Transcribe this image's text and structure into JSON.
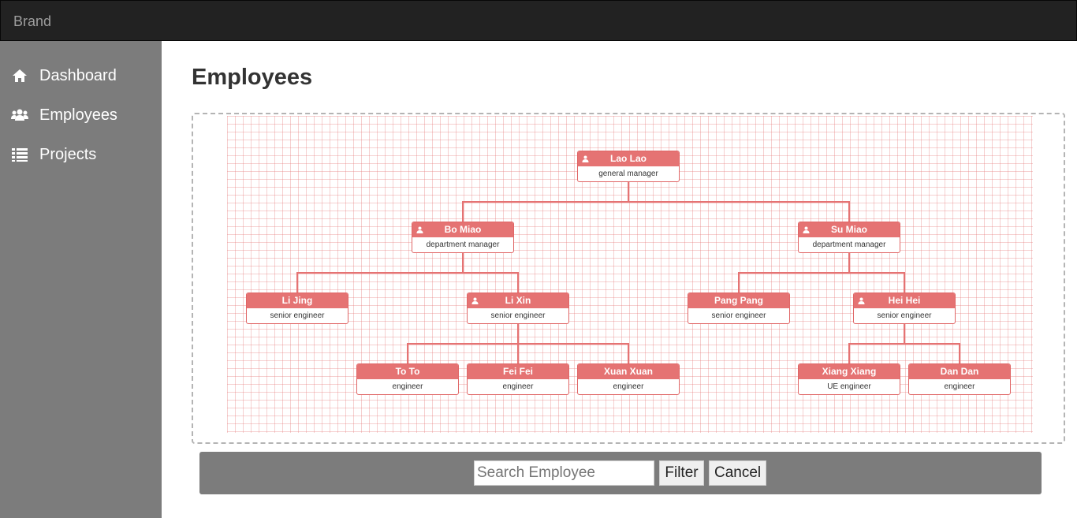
{
  "app": {
    "brand": "Brand"
  },
  "sidebar": {
    "items": [
      {
        "label": "Dashboard",
        "icon": "home-icon"
      },
      {
        "label": "Employees",
        "icon": "users-icon"
      },
      {
        "label": "Projects",
        "icon": "list-icon"
      }
    ]
  },
  "main": {
    "title": "Employees"
  },
  "org": {
    "accent": "#e57373",
    "nodes": [
      {
        "id": "lao",
        "name": "Lao Lao",
        "role": "general manager",
        "icon": "person-icon"
      },
      {
        "id": "bo",
        "name": "Bo Miao",
        "role": "department manager",
        "icon": "person-icon",
        "parent": "lao"
      },
      {
        "id": "su",
        "name": "Su Miao",
        "role": "department manager",
        "icon": "person-icon",
        "parent": "lao"
      },
      {
        "id": "lij",
        "name": "Li Jing",
        "role": "senior engineer",
        "parent": "bo"
      },
      {
        "id": "lix",
        "name": "Li Xin",
        "role": "senior engineer",
        "icon": "person-icon",
        "parent": "bo"
      },
      {
        "id": "pang",
        "name": "Pang Pang",
        "role": "senior engineer",
        "parent": "su"
      },
      {
        "id": "hei",
        "name": "Hei Hei",
        "role": "senior engineer",
        "icon": "person-icon",
        "parent": "su"
      },
      {
        "id": "to",
        "name": "To To",
        "role": "engineer",
        "parent": "lix"
      },
      {
        "id": "fei",
        "name": "Fei Fei",
        "role": "engineer",
        "parent": "lix"
      },
      {
        "id": "xuan",
        "name": "Xuan Xuan",
        "role": "engineer",
        "parent": "lix"
      },
      {
        "id": "xiang",
        "name": "Xiang Xiang",
        "role": "UE engineer",
        "parent": "hei"
      },
      {
        "id": "dan",
        "name": "Dan Dan",
        "role": "engineer",
        "parent": "hei"
      }
    ]
  },
  "filter": {
    "search_placeholder": "Search Employee",
    "filter_label": "Filter",
    "cancel_label": "Cancel"
  }
}
